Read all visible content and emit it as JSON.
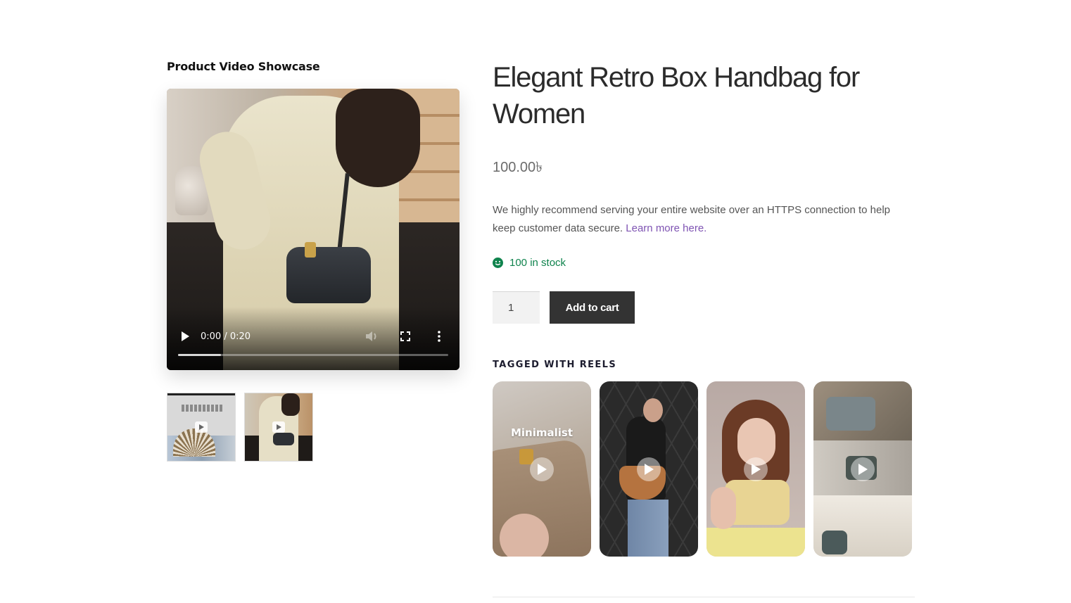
{
  "showcase": {
    "title": "Product Video Showcase",
    "video": {
      "time": "0:00 / 0:20",
      "progress": 0.16,
      "controls": [
        "play-icon",
        "volume-icon",
        "fullscreen-icon",
        "more-icon"
      ]
    },
    "thumbnails": [
      "video-thumbnail-1",
      "video-thumbnail-2"
    ]
  },
  "product": {
    "title": "Elegant Retro Box Handbag for Women",
    "price": "100.00৳",
    "description": "We highly recommend serving your entire website over an HTTPS connection to help keep customer data secure.",
    "learn_more": "Learn more here.",
    "stock": "100 in stock",
    "quantity": "1",
    "add_to_cart": "Add to cart"
  },
  "reels": {
    "heading": "TAGGED WITH REELS",
    "items": [
      {
        "overlay_text": "Minimalist"
      },
      {
        "overlay_text": ""
      },
      {
        "overlay_text": ""
      },
      {
        "overlay_text": ""
      }
    ]
  },
  "colors": {
    "accent_link": "#7f54b3",
    "stock_green": "#0f834d",
    "button_dark": "#333333"
  }
}
